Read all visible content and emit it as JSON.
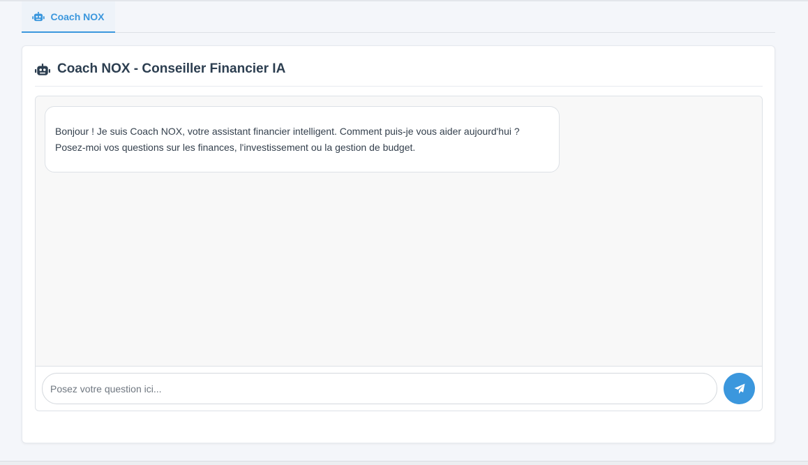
{
  "tabs": [
    {
      "label": "Coach NOX",
      "icon": "robot-icon",
      "active": true
    }
  ],
  "header": {
    "title": "Coach NOX - Conseiller Financier IA",
    "icon": "robot-icon"
  },
  "chat": {
    "messages": [
      {
        "sender": "bot",
        "lines": [
          "Bonjour ! Je suis Coach NOX, votre assistant financier intelligent. Comment puis-je vous aider aujourd'hui ?",
          "Posez-moi vos questions sur les finances, l'investissement ou la gestion de budget."
        ]
      }
    ],
    "input": {
      "value": "",
      "placeholder": "Posez votre question ici..."
    },
    "send_icon": "paper-plane-icon"
  },
  "colors": {
    "accent": "#3b97dd",
    "title": "#2c3e50",
    "chat_background": "#f8f8f8"
  }
}
